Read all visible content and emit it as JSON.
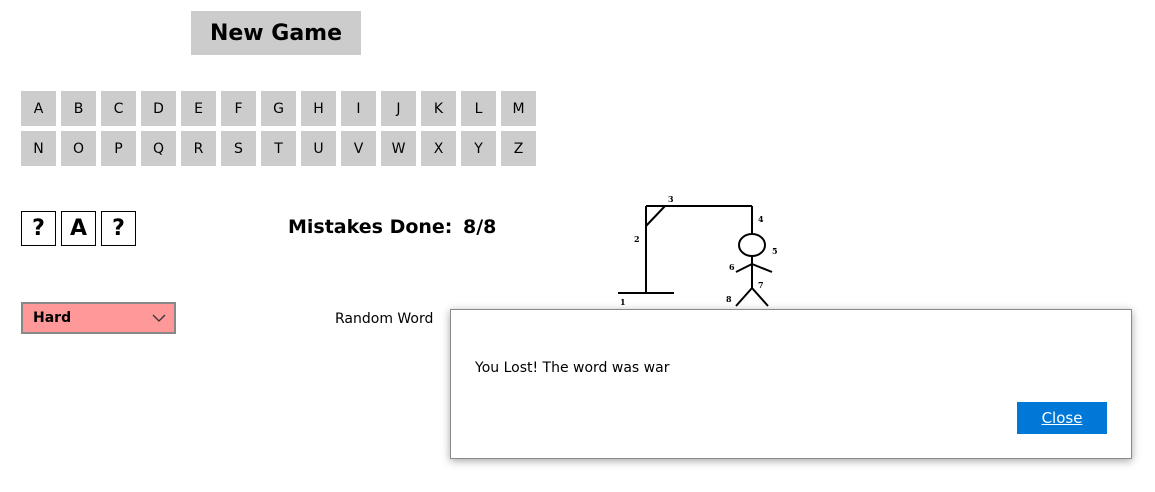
{
  "new_game_label": "New Game",
  "letters_row1": [
    "A",
    "B",
    "C",
    "D",
    "E",
    "F",
    "G",
    "H",
    "I",
    "J",
    "K",
    "L",
    "M"
  ],
  "letters_row2": [
    "N",
    "O",
    "P",
    "Q",
    "R",
    "S",
    "T",
    "U",
    "V",
    "W",
    "X",
    "Y",
    "Z"
  ],
  "word_slots": [
    "?",
    "A",
    "?"
  ],
  "mistakes_label": "Mistakes Done:",
  "mistakes_value": "8/8",
  "difficulty": {
    "selected": "Hard",
    "color": "#ff9999"
  },
  "random_word_label": "Random Word",
  "gallows_step_labels": [
    "1",
    "2",
    "3",
    "4",
    "5",
    "6",
    "7",
    "8"
  ],
  "dialog": {
    "message": "You Lost! The word was war",
    "close_label": "Close",
    "close_color": "#0078d7"
  }
}
